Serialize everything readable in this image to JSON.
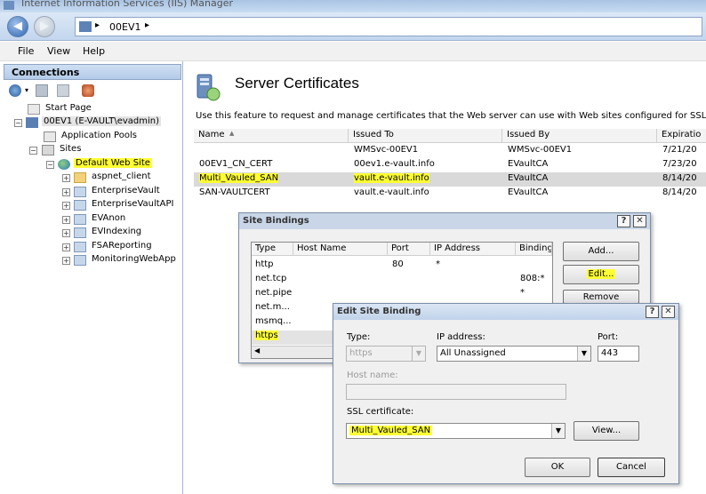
{
  "window": {
    "title": "Internet Information Services (IIS) Manager"
  },
  "address": {
    "crumb": "00EV1",
    "sep": "▸"
  },
  "menu": {
    "file": "File",
    "view": "View",
    "help": "Help"
  },
  "connections": {
    "header": "Connections",
    "tree": {
      "start_page": "Start Page",
      "server": "00EV1 (E-VAULT\\evadmin)",
      "app_pools": "Application Pools",
      "sites": "Sites",
      "default_site": "Default Web Site",
      "children": [
        "aspnet_client",
        "EnterpriseVault",
        "EnterpriseVaultAPI",
        "EVAnon",
        "EVIndexing",
        "FSAReporting",
        "MonitoringWebApp"
      ]
    }
  },
  "main": {
    "title": "Server Certificates",
    "description": "Use this feature to request and manage certificates that the Web server can use with Web sites configured for SSL.",
    "columns": {
      "name": "Name",
      "sort_indicator": "▲",
      "issued_to": "Issued To",
      "issued_by": "Issued By",
      "expiration": "Expiratio"
    },
    "rows": [
      {
        "name": "",
        "issued_to": "WMSvc-00EV1",
        "issued_by": "WMSvc-00EV1",
        "expiration": "7/21/20"
      },
      {
        "name": "00EV1_CN_CERT",
        "issued_to": "00ev1.e-vault.info",
        "issued_by": "EVaultCA",
        "expiration": "7/23/20"
      },
      {
        "name": "Multi_Vauled_SAN",
        "issued_to": "vault.e-vault.info",
        "issued_by": "EVaultCA",
        "expiration": "8/14/20"
      },
      {
        "name": "SAN-VAULTCERT",
        "issued_to": "vault.e-vault.info",
        "issued_by": "EVaultCA",
        "expiration": "8/14/20"
      }
    ]
  },
  "site_bindings": {
    "title": "Site Bindings",
    "help": "?",
    "close": "✕",
    "columns": {
      "type": "Type",
      "host": "Host Name",
      "port": "Port",
      "ip": "IP Address",
      "binding": "Binding"
    },
    "rows": [
      {
        "type": "http",
        "port": "80",
        "ip": "*",
        "binding": ""
      },
      {
        "type": "net.tcp",
        "port": "",
        "ip": "",
        "binding": "808:*"
      },
      {
        "type": "net.pipe",
        "port": "",
        "ip": "",
        "binding": "*"
      },
      {
        "type": "net.m...",
        "port": "",
        "ip": "",
        "binding": ""
      },
      {
        "type": "msmq...",
        "port": "",
        "ip": "",
        "binding": ""
      },
      {
        "type": "https",
        "port": "",
        "ip": "",
        "binding": ""
      }
    ],
    "buttons": {
      "add": "Add...",
      "edit": "Edit...",
      "remove": "Remove"
    }
  },
  "edit_binding": {
    "title": "Edit Site Binding",
    "help": "?",
    "close": "✕",
    "type_label": "Type:",
    "type_value": "https",
    "ip_label": "IP address:",
    "ip_value": "All Unassigned",
    "port_label": "Port:",
    "port_value": "443",
    "host_label": "Host name:",
    "host_value": "",
    "ssl_label": "SSL certificate:",
    "ssl_value": "Multi_Vauled_SAN",
    "view_button": "View...",
    "ok_button": "OK",
    "cancel_button": "Cancel"
  },
  "colors": {
    "highlight": "#ffff33",
    "accent": "#2f64b0"
  },
  "icons": [
    "back-arrow-icon",
    "forward-arrow-icon",
    "server-icon",
    "globe-icon",
    "folder-icon",
    "application-icon",
    "certificate-icon",
    "dropdown-arrow-icon"
  ]
}
